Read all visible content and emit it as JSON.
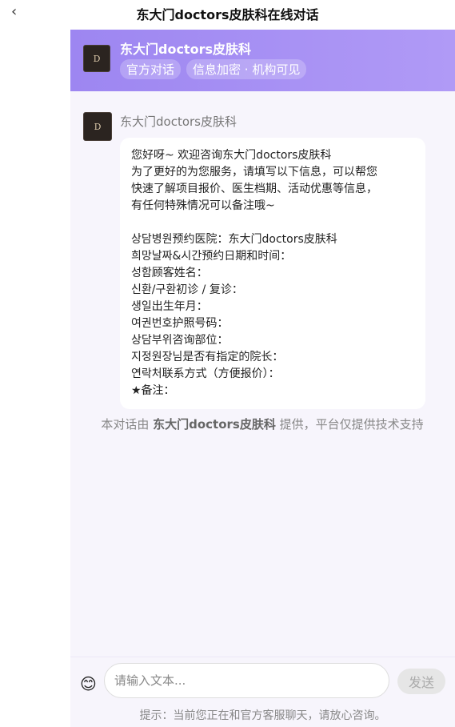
{
  "nav": {
    "back_icon": "‹",
    "title": "东大门doctors皮肤科在线对话"
  },
  "header": {
    "logo_text": "D",
    "name": "东大门doctors皮肤科",
    "tags": [
      "官方对话",
      "信息加密 · 机构可见"
    ]
  },
  "message": {
    "sender": "东大门doctors皮肤科",
    "lines": [
      "您好呀~ 欢迎咨询东大门doctors皮肤科",
      "为了更好的为您服务，请填写以下信息，可以帮您",
      "快速了解项目报价、医生档期、活动优惠等信息，",
      "有任何特殊情况可以备注哦~",
      "",
      "상담병원预约医院：东大门doctors皮肤科",
      "희망날짜&시간预约日期和时间：",
      "성함顾客姓名：",
      "신환/구환初诊 / 复诊：",
      "생일出生年月：",
      "여권번호护照号码：",
      "상담부위咨询部位：",
      "지정원장님是否有指定的院长：",
      "연락처联系方式（方便报价）：",
      "★备注："
    ]
  },
  "notice": {
    "prefix": "本对话由 ",
    "brand": "东大门doctors皮肤科",
    "suffix": " 提供，平台仅提供技术支持"
  },
  "input": {
    "emoji_icon": "😊",
    "placeholder": "请输入文本...",
    "send_label": "发送",
    "hint": "提示：当前您正在和官方客服聊天，请放心咨询。"
  }
}
